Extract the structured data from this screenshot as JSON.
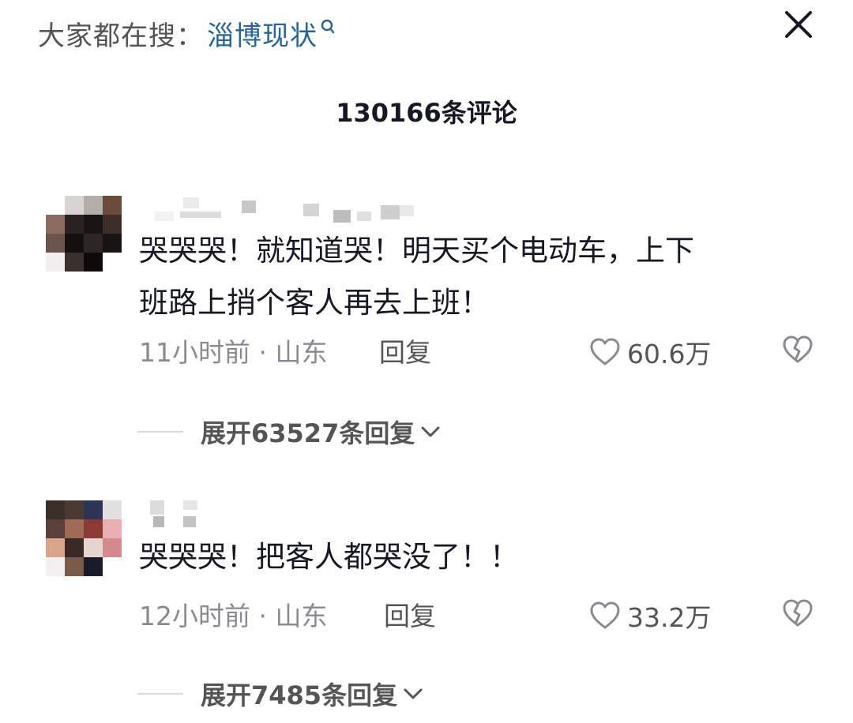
{
  "search": {
    "prefix": "大家都在搜：",
    "term": "淄博现状"
  },
  "header": {
    "comment_count": "130166条评论"
  },
  "comments": [
    {
      "text_line1": "哭哭哭！就知道哭！明天买个电动车，上下",
      "text_line2": "班路上捎个客人再去上班！",
      "time_location": "11小时前 · 山东",
      "reply_label": "回复",
      "likes": "60.6万",
      "expand_label": "展开63527条回复"
    },
    {
      "text_line1": "哭哭哭！把客人都哭没了！！",
      "time_location": "12小时前 · 山东",
      "reply_label": "回复",
      "likes": "33.2万",
      "expand_label": "展开7485条回复"
    }
  ],
  "colors": {
    "link": "#2a6496",
    "secondary_text": "#8a8b91",
    "primary_text": "#161823"
  },
  "icons": [
    "search-icon",
    "close-icon",
    "heart-icon",
    "broken-heart-icon",
    "chevron-down-icon"
  ]
}
